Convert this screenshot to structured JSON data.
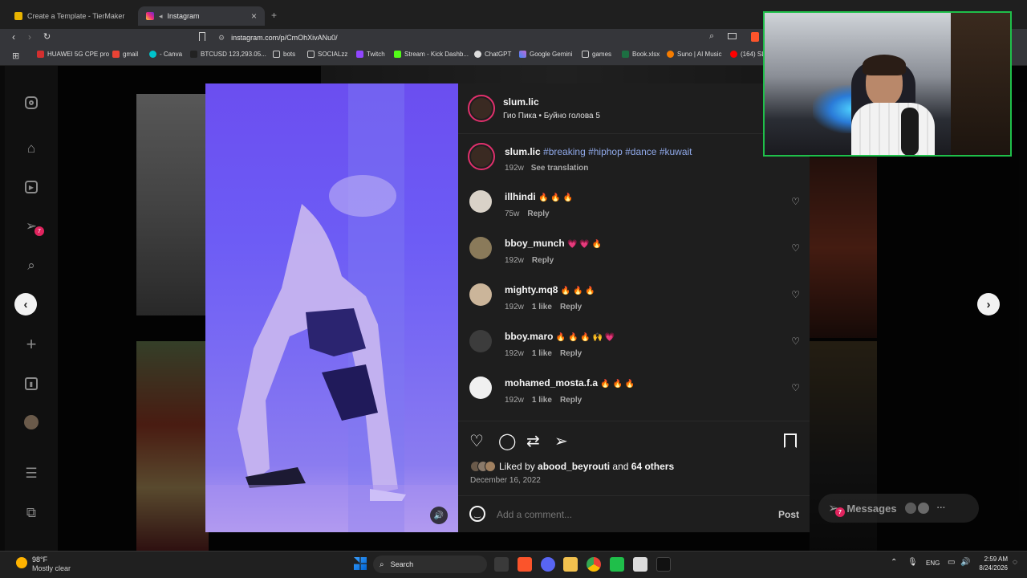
{
  "browser": {
    "tabs": [
      {
        "label": "Create a Template - TierMaker",
        "active": false
      },
      {
        "label": "Instagram",
        "active": true
      }
    ],
    "new_tab": "+",
    "close_tab": "×",
    "url": "instagram.com/p/CmOhXivANu0/",
    "bookmarks": [
      "HUAWEI 5G CPE pro",
      "gmail",
      "- Canva",
      "BTCUSD 123,293.05...",
      "bots",
      "SOCIALzz",
      "Twitch",
      "Stream - Kick Dashb...",
      "ChatGPT",
      "Google Gemini",
      "games",
      "Book.xlsx",
      "Suno | AI Music",
      "(164) SL"
    ]
  },
  "sidebar": {
    "notification_count": "7"
  },
  "post": {
    "author": "slum.lic",
    "audio": "Гио Пика • Буйно голова 5",
    "caption": {
      "user": "slum.lic",
      "text": "#breaking #hiphop #dance #kuwait",
      "age": "192w",
      "translate": "See translation"
    },
    "comments": [
      {
        "user": "illhindi",
        "text": "🔥 🔥 🔥",
        "age": "75w",
        "likes": "",
        "reply": "Reply"
      },
      {
        "user": "bboy_munch",
        "text": "💗 💗 🔥",
        "age": "192w",
        "likes": "",
        "reply": "Reply"
      },
      {
        "user": "mighty.mq8",
        "text": "🔥 🔥 🔥",
        "age": "192w",
        "likes": "1 like",
        "reply": "Reply"
      },
      {
        "user": "bboy.maro",
        "text": "🔥 🔥 🔥 🙌 💗",
        "age": "192w",
        "likes": "1 like",
        "reply": "Reply"
      },
      {
        "user": "mohamed_mosta.f.a",
        "text": "🔥 🔥 🔥",
        "age": "192w",
        "likes": "1 like",
        "reply": "Reply"
      }
    ],
    "liked_by_prefix": "Liked by",
    "liked_by_user": "abood_beyrouti",
    "liked_by_and": "and",
    "liked_by_others": "64 others",
    "date": "December 16, 2022",
    "comment_placeholder": "Add a comment...",
    "post_button": "Post"
  },
  "messages": {
    "label": "Messages",
    "count": "7"
  },
  "taskbar": {
    "weather_temp": "98°F",
    "weather_desc": "Mostly clear",
    "search": "Search",
    "lang": "ENG",
    "time": "2:59 AM",
    "date": "8/24/2026"
  },
  "colors": {
    "story_ring": "#e1306c",
    "webcam_border": "#1fbf4a",
    "panel_bg": "#1e1e1e",
    "video_tint": "#6b4ef0"
  }
}
